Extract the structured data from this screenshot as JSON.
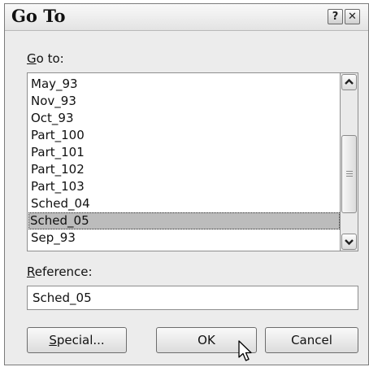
{
  "dialog": {
    "title": "Go To",
    "help_glyph": "?",
    "close_glyph": "✕"
  },
  "goto": {
    "label_mnemonic": "G",
    "label_rest": "o to:",
    "items": [
      {
        "label": "May_93",
        "selected": false
      },
      {
        "label": "Nov_93",
        "selected": false
      },
      {
        "label": "Oct_93",
        "selected": false
      },
      {
        "label": "Part_100",
        "selected": false
      },
      {
        "label": "Part_101",
        "selected": false
      },
      {
        "label": "Part_102",
        "selected": false
      },
      {
        "label": "Part_103",
        "selected": false
      },
      {
        "label": "Sched_04",
        "selected": false
      },
      {
        "label": "Sched_05",
        "selected": true
      },
      {
        "label": "Sep_93",
        "selected": false
      }
    ]
  },
  "reference": {
    "label_mnemonic": "R",
    "label_rest": "eference:",
    "value": "Sched_05"
  },
  "buttons": {
    "special_mnemonic": "S",
    "special_rest": "pecial...",
    "ok_label": "OK",
    "cancel_label": "Cancel"
  },
  "icons": {
    "scroll_up": "chevron-up-icon",
    "scroll_down": "chevron-down-icon",
    "cursor": "mouse-pointer-icon"
  }
}
